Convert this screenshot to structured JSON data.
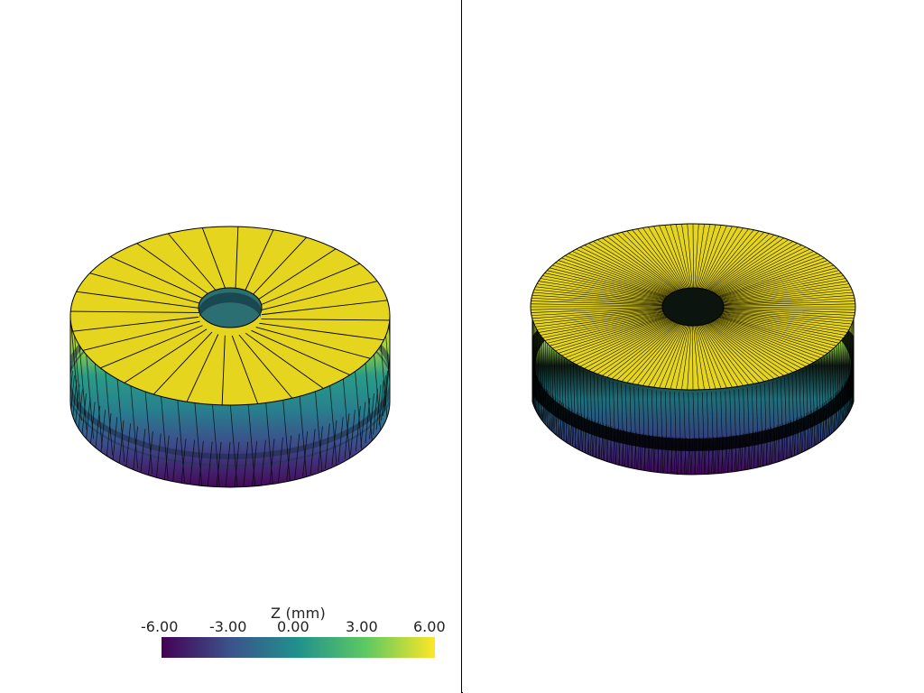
{
  "colorbar": {
    "title": "Z (mm)",
    "ticks": [
      "-6.00",
      "-3.00",
      "0.00",
      "3.00",
      "6.00"
    ],
    "colormap": "viridis",
    "colors": [
      "#440154",
      "#3b528b",
      "#21918c",
      "#5ec962",
      "#fde725"
    ]
  },
  "colors": {
    "top_face": "#e6d51f",
    "edge_lines": "#000000",
    "background": "#ffffff"
  }
}
